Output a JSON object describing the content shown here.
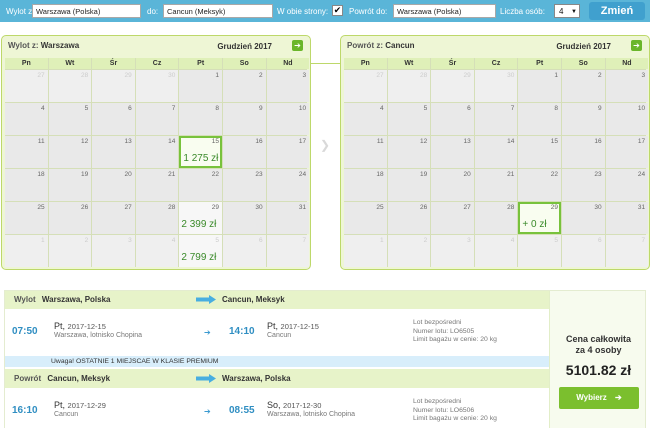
{
  "search": {
    "from_label": "Wylot z:",
    "from_value": "Warszawa (Polska)",
    "to_label": "do:",
    "to_value": "Cancun (Meksyk)",
    "roundtrip_label": "W obie strony:",
    "roundtrip_check": "✔",
    "return_label": "Powrót do:",
    "return_value": "Warszawa (Polska)",
    "persons_label": "Liczba osób:",
    "persons_value": "4",
    "persons_arrow": "▼",
    "change_button": "Zmień"
  },
  "calendar_out": {
    "label": "Wylot z:",
    "city": "Warszawa",
    "month": "Grudzień 2017",
    "next_icon": "➔",
    "weekdays": [
      "Pn",
      "Wt",
      "Śr",
      "Cz",
      "Pt",
      "So",
      "Nd"
    ],
    "days": [
      {
        "d": "27",
        "other": true
      },
      {
        "d": "28",
        "other": true
      },
      {
        "d": "29",
        "other": true
      },
      {
        "d": "30",
        "other": true
      },
      {
        "d": "1"
      },
      {
        "d": "2"
      },
      {
        "d": "3"
      },
      {
        "d": "4"
      },
      {
        "d": "5"
      },
      {
        "d": "6"
      },
      {
        "d": "7"
      },
      {
        "d": "8"
      },
      {
        "d": "9"
      },
      {
        "d": "10"
      },
      {
        "d": "11"
      },
      {
        "d": "12"
      },
      {
        "d": "13"
      },
      {
        "d": "14"
      },
      {
        "d": "15",
        "price": "1 275 zł",
        "selected": true
      },
      {
        "d": "16"
      },
      {
        "d": "17"
      },
      {
        "d": "18"
      },
      {
        "d": "19"
      },
      {
        "d": "20"
      },
      {
        "d": "21"
      },
      {
        "d": "22"
      },
      {
        "d": "23"
      },
      {
        "d": "24"
      },
      {
        "d": "25"
      },
      {
        "d": "26"
      },
      {
        "d": "27"
      },
      {
        "d": "28"
      },
      {
        "d": "29",
        "price": "2 399 zł"
      },
      {
        "d": "30"
      },
      {
        "d": "31"
      },
      {
        "d": "1",
        "other": true
      },
      {
        "d": "2",
        "other": true
      },
      {
        "d": "3",
        "other": true
      },
      {
        "d": "4",
        "other": true
      },
      {
        "d": "5",
        "other": true,
        "price": "2 799 zł"
      },
      {
        "d": "6",
        "other": true
      },
      {
        "d": "7",
        "other": true
      }
    ]
  },
  "calendar_ret": {
    "label": "Powrót z:",
    "city": "Cancun",
    "month": "Grudzień 2017",
    "next_icon": "➔",
    "weekdays": [
      "Pn",
      "Wt",
      "Śr",
      "Cz",
      "Pt",
      "So",
      "Nd"
    ],
    "days": [
      {
        "d": "27",
        "other": true
      },
      {
        "d": "28",
        "other": true
      },
      {
        "d": "29",
        "other": true
      },
      {
        "d": "30",
        "other": true
      },
      {
        "d": "1"
      },
      {
        "d": "2"
      },
      {
        "d": "3"
      },
      {
        "d": "4"
      },
      {
        "d": "5"
      },
      {
        "d": "6"
      },
      {
        "d": "7"
      },
      {
        "d": "8"
      },
      {
        "d": "9"
      },
      {
        "d": "10"
      },
      {
        "d": "11"
      },
      {
        "d": "12"
      },
      {
        "d": "13"
      },
      {
        "d": "14"
      },
      {
        "d": "15"
      },
      {
        "d": "16"
      },
      {
        "d": "17"
      },
      {
        "d": "18"
      },
      {
        "d": "19"
      },
      {
        "d": "20"
      },
      {
        "d": "21"
      },
      {
        "d": "22"
      },
      {
        "d": "23"
      },
      {
        "d": "24"
      },
      {
        "d": "25"
      },
      {
        "d": "26"
      },
      {
        "d": "27"
      },
      {
        "d": "28"
      },
      {
        "d": "29",
        "price": "+ 0 zł",
        "selected": true
      },
      {
        "d": "30"
      },
      {
        "d": "31"
      },
      {
        "d": "1",
        "other": true
      },
      {
        "d": "2",
        "other": true
      },
      {
        "d": "3",
        "other": true
      },
      {
        "d": "4",
        "other": true
      },
      {
        "d": "5",
        "other": true
      },
      {
        "d": "6",
        "other": true
      },
      {
        "d": "7",
        "other": true
      }
    ]
  },
  "outbound": {
    "kind": "Wylot",
    "from": "Warszawa, Polska",
    "to": "Cancun, Meksyk",
    "dep_time": "07:50",
    "dep_day": "Pt,",
    "dep_date": "2017-12-15",
    "dep_place": "Warszawa, lotnisko Chopina",
    "arr_time": "14:10",
    "arr_day": "Pt,",
    "arr_date": "2017-12-15",
    "arr_place": "Cancun",
    "info1": "Lot bezpośredni",
    "info2": "Numer lotu: LO6505",
    "info3": "Limit bagażu w cenie: 20 kg",
    "arrow": "➔"
  },
  "notice": {
    "prefix": "Uwaga!",
    "text": "OSTATNIE 1 MIEJSCAE W KLASIE PREMIUM"
  },
  "inbound": {
    "kind": "Powrót",
    "from": "Cancun, Meksyk",
    "to": "Warszawa, Polska",
    "dep_time": "16:10",
    "dep_day": "Pt,",
    "dep_date": "2017-12-29",
    "dep_place": "Cancun",
    "arr_time": "08:55",
    "arr_day": "So,",
    "arr_date": "2017-12-30",
    "arr_place": "Warszawa, lotnisko Chopina",
    "info1": "Lot bezpośredni",
    "info2": "Numer lotu: LO6506",
    "info3": "Limit bagażu w cenie: 20 kg",
    "arrow": "➔"
  },
  "summary": {
    "label_line1": "Cena całkowita",
    "label_line2": "za 4 osoby",
    "total": "5101.82 zł",
    "select_button": "Wybierz",
    "select_icon": "➔"
  },
  "colors": {
    "searchbar": "#5ab5d8",
    "accent_green": "#7bbf2e",
    "price_green": "#3a8a2a",
    "time_blue": "#2f8ec2"
  }
}
